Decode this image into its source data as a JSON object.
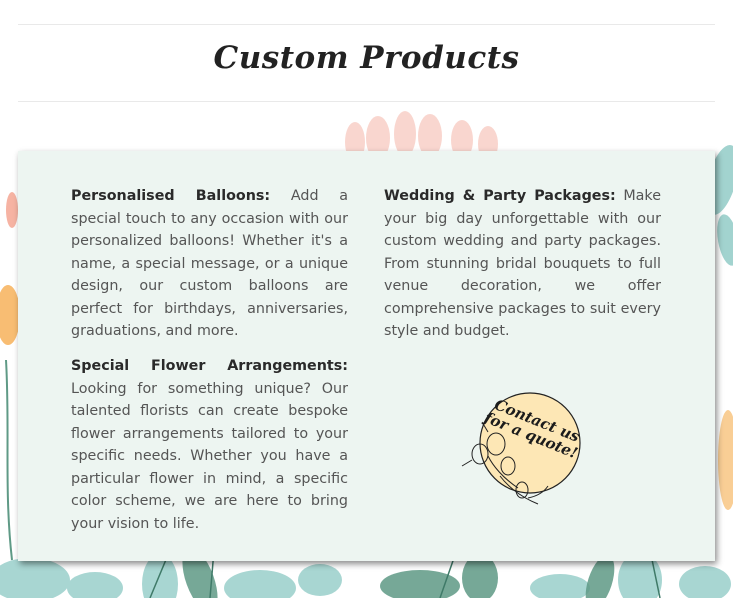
{
  "page_title": "Custom Products",
  "products": [
    {
      "title": "Personalised Balloons:",
      "text": "Add a special touch to any occasion with our personalized balloons! Whether it's a name, a special message, or a unique design, our custom balloons are perfect for birthdays, anniversaries, graduations, and more."
    },
    {
      "title": "Special Flower Arrangements:",
      "text": "Looking for something unique? Our talented florists can create bespoke flower arrangements tailored to your specific needs. Whether you have a particular flower in mind, a specific color scheme, we are here to bring your vision to life."
    },
    {
      "title": "Wedding & Party Packages:",
      "text": "Make your big day unforgettable with our custom wedding and party packages. From stunning bridal bouquets to full venue decoration, we offer comprehensive packages to suit every style and budget."
    }
  ],
  "contact_badge": {
    "line1": "Contact us",
    "line2": "for a quote!"
  },
  "colors": {
    "card_bg": "#edf5f1",
    "badge_circle": "#fde7b5",
    "accent_orange": "#f7b25b",
    "accent_pink": "#f7c9c0",
    "foliage_teal": "#8cc9c4",
    "foliage_green": "#5f9a86"
  }
}
